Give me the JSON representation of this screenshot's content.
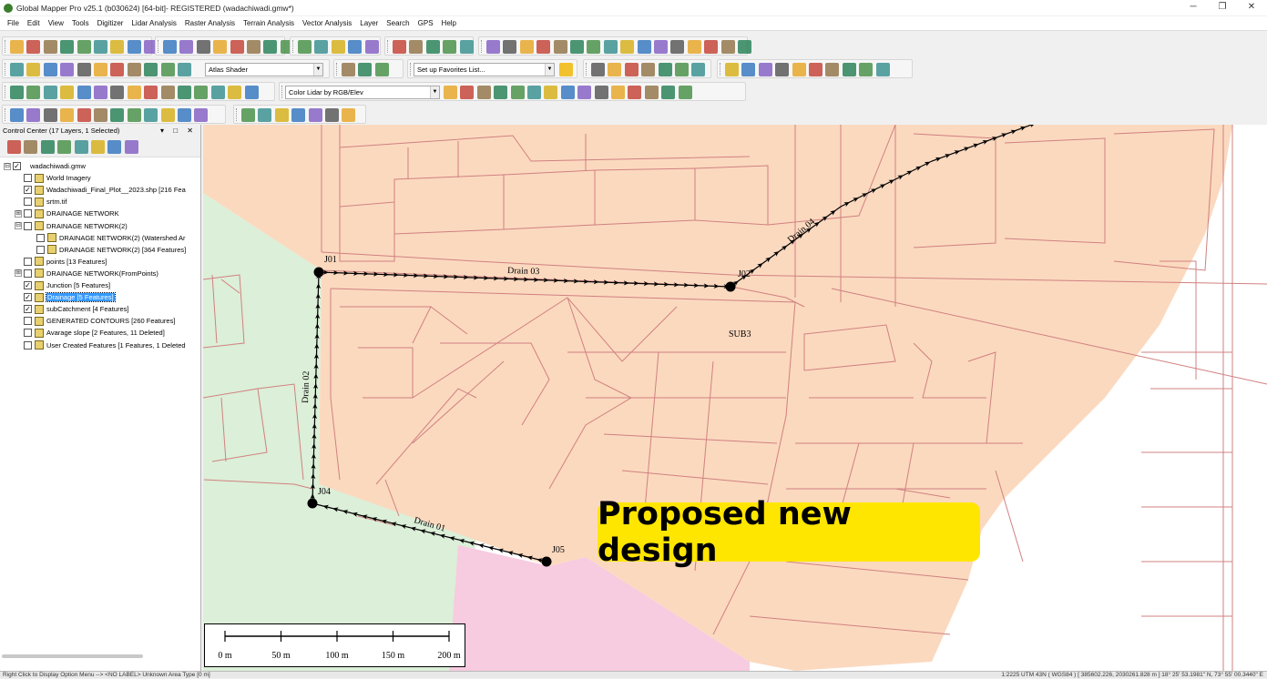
{
  "window": {
    "title": "Global Mapper Pro v25.1 (b030624) [64-bit]- REGISTERED (wadachiwadi.gmw*)",
    "minimize": "─",
    "maximize": "❐",
    "close": "✕"
  },
  "menu": [
    "File",
    "Edit",
    "View",
    "Tools",
    "Digitizer",
    "Lidar Analysis",
    "Raster Analysis",
    "Terrain Analysis",
    "Vector Analysis",
    "Layer",
    "Search",
    "GPS",
    "Help"
  ],
  "toolbar": {
    "shader_select": "Atlas Shader",
    "favorites_select": "Set up Favorites List...",
    "lidar_color_select": "Color Lidar by RGB/Elev"
  },
  "control_center": {
    "title": "Control Center (17 Layers, 1 Selected)",
    "header_buttons": "▾ □ ✕",
    "layers": [
      {
        "label": "wadachiwadi.gmw",
        "checked": true,
        "expander": "⊟",
        "level": 0
      },
      {
        "label": "World Imagery",
        "checked": false,
        "level": 1
      },
      {
        "label": "Wadachiwadi_Final_Plot__2023.shp [216 Fea",
        "checked": true,
        "level": 1
      },
      {
        "label": "srtm.tif",
        "checked": false,
        "level": 1
      },
      {
        "label": "DRAINAGE NETWORK",
        "checked": false,
        "expander": "⊞",
        "level": 1
      },
      {
        "label": "DRAINAGE NETWORK(2)",
        "checked": false,
        "expander": "⊟",
        "level": 1
      },
      {
        "label": "DRAINAGE NETWORK(2) (Watershed Ar",
        "checked": false,
        "level": 2
      },
      {
        "label": "DRAINAGE NETWORK(2) [364 Features]",
        "checked": false,
        "level": 2
      },
      {
        "label": "points [13 Features]",
        "checked": false,
        "level": 1
      },
      {
        "label": "DRAINAGE NETWORK(FromPoints)",
        "checked": false,
        "expander": "⊞",
        "level": 1
      },
      {
        "label": "Junction [5 Features]",
        "checked": true,
        "level": 1
      },
      {
        "label": "Drainage [5 Features]",
        "checked": true,
        "selected": true,
        "level": 1
      },
      {
        "label": "subCatchment [4 Features]",
        "checked": true,
        "level": 1
      },
      {
        "label": "GENERATED CONTOURS [260 Features]",
        "checked": false,
        "level": 1
      },
      {
        "label": "Avarage slope [2 Features, 11 Deleted]",
        "checked": false,
        "level": 1
      },
      {
        "label": "User Created Features [1 Features, 1 Deleted",
        "checked": false,
        "level": 1
      }
    ]
  },
  "map": {
    "junctions": [
      "J01",
      "J02",
      "J04",
      "J05"
    ],
    "drains": [
      "Drain 01",
      "Drain 02",
      "Drain 03",
      "Drain 04"
    ],
    "subcatchment_label": "SUB3",
    "callout": "Proposed new design",
    "scale_labels": [
      "0 m",
      "50 m",
      "100 m",
      "150 m",
      "200 m"
    ],
    "colors": {
      "peach": "#fbd9bf",
      "green": "#dcefd8",
      "pink": "#f7cbe0",
      "parcel_line": "#d08080",
      "callout": "#ffe600"
    }
  },
  "statusbar": {
    "left": "Right Click to Display Option Menu --> <NO LABEL> Unknown Area Type [0 m]",
    "right": "1:2225  UTM 43N ( WGS84 ) [ 385602.226, 2030261.828 m ]  18° 25' 53.1981\" N, 73° 55' 00.3440\" E"
  }
}
